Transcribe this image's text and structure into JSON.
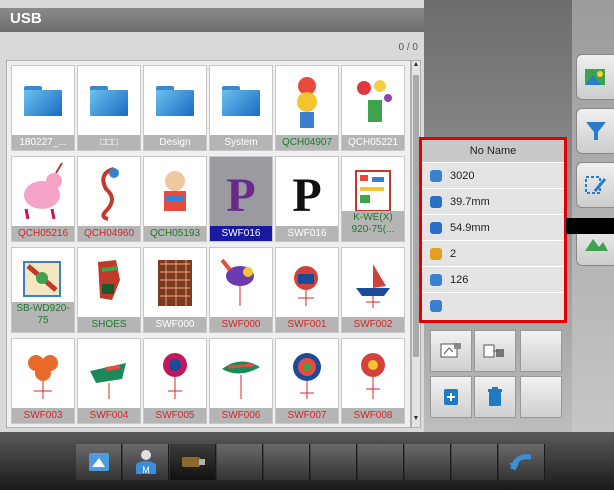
{
  "window": {
    "title": "USB",
    "page_counter": "0 / 0"
  },
  "files": [
    {
      "label": "180227_...",
      "color": "white",
      "type": "folder"
    },
    {
      "label": "□□□",
      "color": "white",
      "type": "folder"
    },
    {
      "label": "Design",
      "color": "white",
      "type": "folder"
    },
    {
      "label": "System",
      "color": "white",
      "type": "folder"
    },
    {
      "label": "QCH04907",
      "color": "green",
      "type": "design",
      "icon": "clown-icon"
    },
    {
      "label": "QCH05221",
      "color": "white",
      "type": "design",
      "icon": "flower-bouquet-icon"
    },
    {
      "label": "QCH05216",
      "color": "red",
      "type": "design",
      "icon": "unicorn-icon"
    },
    {
      "label": "QCH04960",
      "color": "red",
      "type": "design",
      "icon": "seahorse-icon"
    },
    {
      "label": "QCH05193",
      "color": "green",
      "type": "design",
      "icon": "bear-icon"
    },
    {
      "label": "SWF016",
      "color": "white",
      "type": "design",
      "icon": "letter-p-purple-icon",
      "selected": true,
      "glyph": "P"
    },
    {
      "label": "SWF016",
      "color": "white",
      "type": "design",
      "icon": "letter-p-black-icon",
      "glyph": "P"
    },
    {
      "label": "K-WE(X) 920-75(...",
      "color": "green",
      "type": "design",
      "icon": "pattern-icon",
      "multi": true
    },
    {
      "label": "SB-WD920-75",
      "color": "green",
      "type": "design",
      "icon": "flag-icon",
      "multi": true
    },
    {
      "label": "SHOES",
      "color": "green",
      "type": "design",
      "icon": "shoes-icon"
    },
    {
      "label": "SWF000",
      "color": "white",
      "type": "design",
      "icon": "texture-icon"
    },
    {
      "label": "SWF000",
      "color": "red",
      "type": "design",
      "icon": "bird-icon"
    },
    {
      "label": "SWF001",
      "color": "red",
      "type": "design",
      "icon": "rooster-icon"
    },
    {
      "label": "SWF002",
      "color": "red",
      "type": "design",
      "icon": "ship-icon"
    },
    {
      "label": "SWF003",
      "color": "red",
      "type": "design",
      "icon": "orange-flower-icon"
    },
    {
      "label": "SWF004",
      "color": "red",
      "type": "design",
      "icon": "parrot-icon"
    },
    {
      "label": "SWF005",
      "color": "red",
      "type": "design",
      "icon": "pink-tree-icon"
    },
    {
      "label": "SWF006",
      "color": "red",
      "type": "design",
      "icon": "fish-icon"
    },
    {
      "label": "SWF007",
      "color": "red",
      "type": "design",
      "icon": "medallion-icon"
    },
    {
      "label": "SWF008",
      "color": "red",
      "type": "design",
      "icon": "red-flower-icon"
    }
  ],
  "info": {
    "name": "No Name",
    "rows": [
      {
        "icon": "stitch-count-icon",
        "value": "3020",
        "color": "#3a7fd0"
      },
      {
        "icon": "width-icon",
        "value": "39.7mm",
        "color": "#2a70c8"
      },
      {
        "icon": "height-icon",
        "value": "54.9mm",
        "color": "#2a70c8"
      },
      {
        "icon": "color-count-icon",
        "value": "2",
        "color": "#e0a020"
      },
      {
        "icon": "color-change-icon",
        "value": "126",
        "color": "#3a7fd0"
      },
      {
        "icon": "time-icon",
        "value": "",
        "color": "#3a7fd0"
      }
    ]
  },
  "colors": {
    "highlight": "#e40000",
    "selected": "#1a1aa0"
  }
}
